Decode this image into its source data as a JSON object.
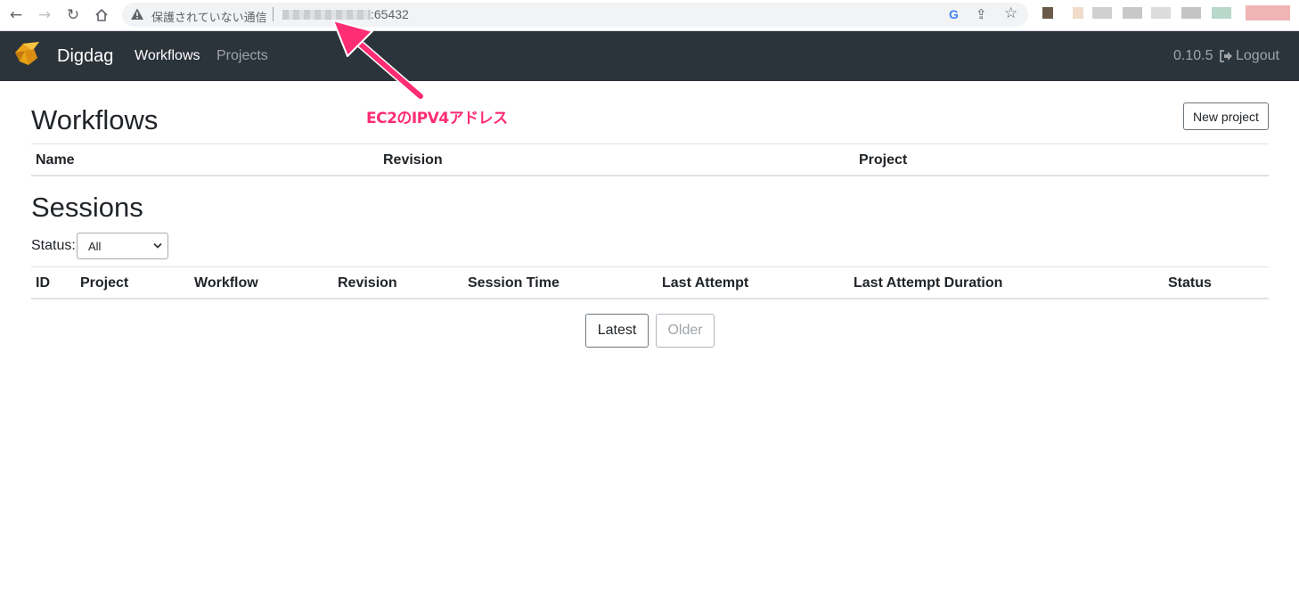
{
  "browser": {
    "security_label": "保護されていない通信",
    "url_port": ":65432",
    "google_glyph": "G"
  },
  "navbar": {
    "brand": "Digdag",
    "links": [
      {
        "label": "Workflows",
        "active": true
      },
      {
        "label": "Projects",
        "active": false
      }
    ],
    "version": "0.10.5",
    "logout_label": "Logout"
  },
  "workflows": {
    "title": "Workflows",
    "new_project_label": "New project",
    "columns": [
      "Name",
      "Revision",
      "Project"
    ],
    "rows": []
  },
  "sessions": {
    "title": "Sessions",
    "status_label": "Status:",
    "status_selected": "All",
    "columns": [
      "ID",
      "Project",
      "Workflow",
      "Revision",
      "Session Time",
      "Last Attempt",
      "Last Attempt Duration",
      "Status"
    ],
    "rows": []
  },
  "pagination": {
    "latest_label": "Latest",
    "older_label": "Older",
    "older_disabled": true
  },
  "annotation": {
    "text": "EC2のIPV4アドレス",
    "color": "#ff2d73"
  },
  "colors": {
    "navbar_bg": "#2b333b",
    "accent": "#ff2d73"
  }
}
